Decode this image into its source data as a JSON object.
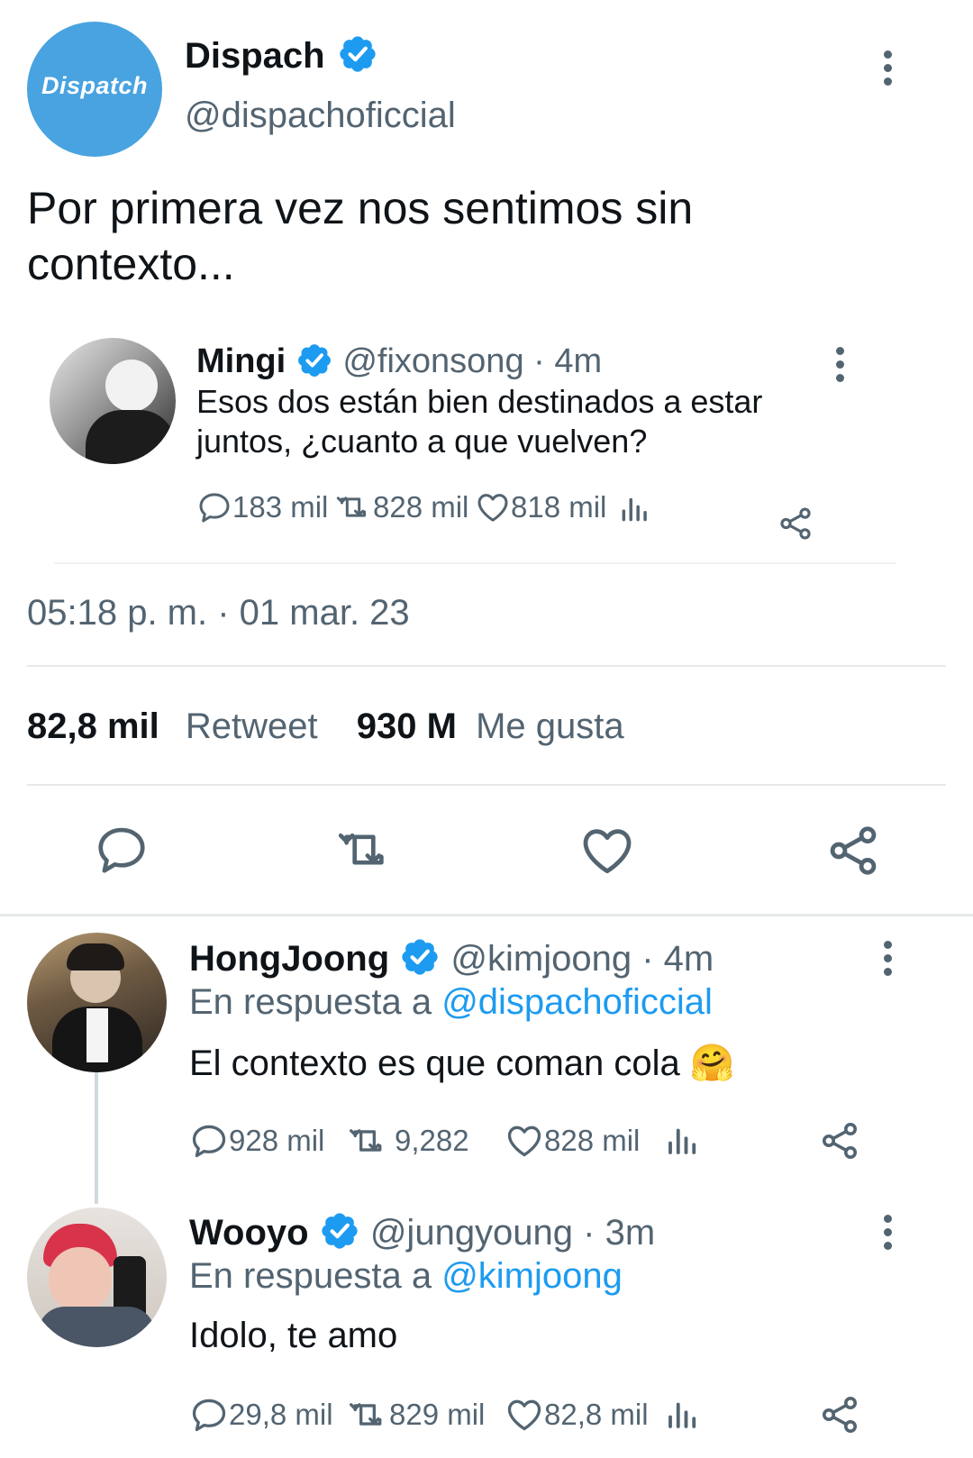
{
  "colors": {
    "accent": "#1d9bf0",
    "muted": "#536471",
    "text": "#0f1419",
    "divider": "#e7e9ea"
  },
  "main_tweet": {
    "name": "Dispach",
    "handle": "@dispachoficcial",
    "avatar_text": "Dispatch",
    "text": "Por primera vez nos sentimos sin contexto...",
    "timestamp": "05:18 p. m. · 01 mar. 23",
    "retweets_count": "82,8 mil",
    "retweets_label": "Retweet",
    "likes_count": "930 M",
    "likes_label": "Me gusta"
  },
  "quoted_tweet": {
    "name": "Mingi",
    "handle": "@fixonsong",
    "time": "· 4m",
    "text": "Esos dos están bien destinados a estar juntos, ¿cuanto a que vuelven?",
    "replies": "183 mil",
    "retweets": "828 mil",
    "likes": "818 mil"
  },
  "replies": [
    {
      "name": "HongJoong",
      "handle": "@kimjoong",
      "time": "· 4m",
      "reply_prefix": "En respuesta a",
      "reply_to": "@dispachoficcial",
      "text": "El contexto es que coman cola 🤗",
      "replies": "928 mil",
      "retweets": "9,282",
      "likes": "828 mil"
    },
    {
      "name": "Wooyo",
      "handle": "@jungyoung",
      "time": "· 3m",
      "reply_prefix": "En respuesta a",
      "reply_to": "@kimjoong",
      "text": "Idolo, te amo",
      "replies": "29,8 mil",
      "retweets": "829 mil",
      "likes": "82,8 mil"
    }
  ],
  "icons": [
    "verified-badge-icon",
    "more-icon",
    "reply-icon",
    "retweet-icon",
    "like-icon",
    "views-icon",
    "share-icon"
  ]
}
